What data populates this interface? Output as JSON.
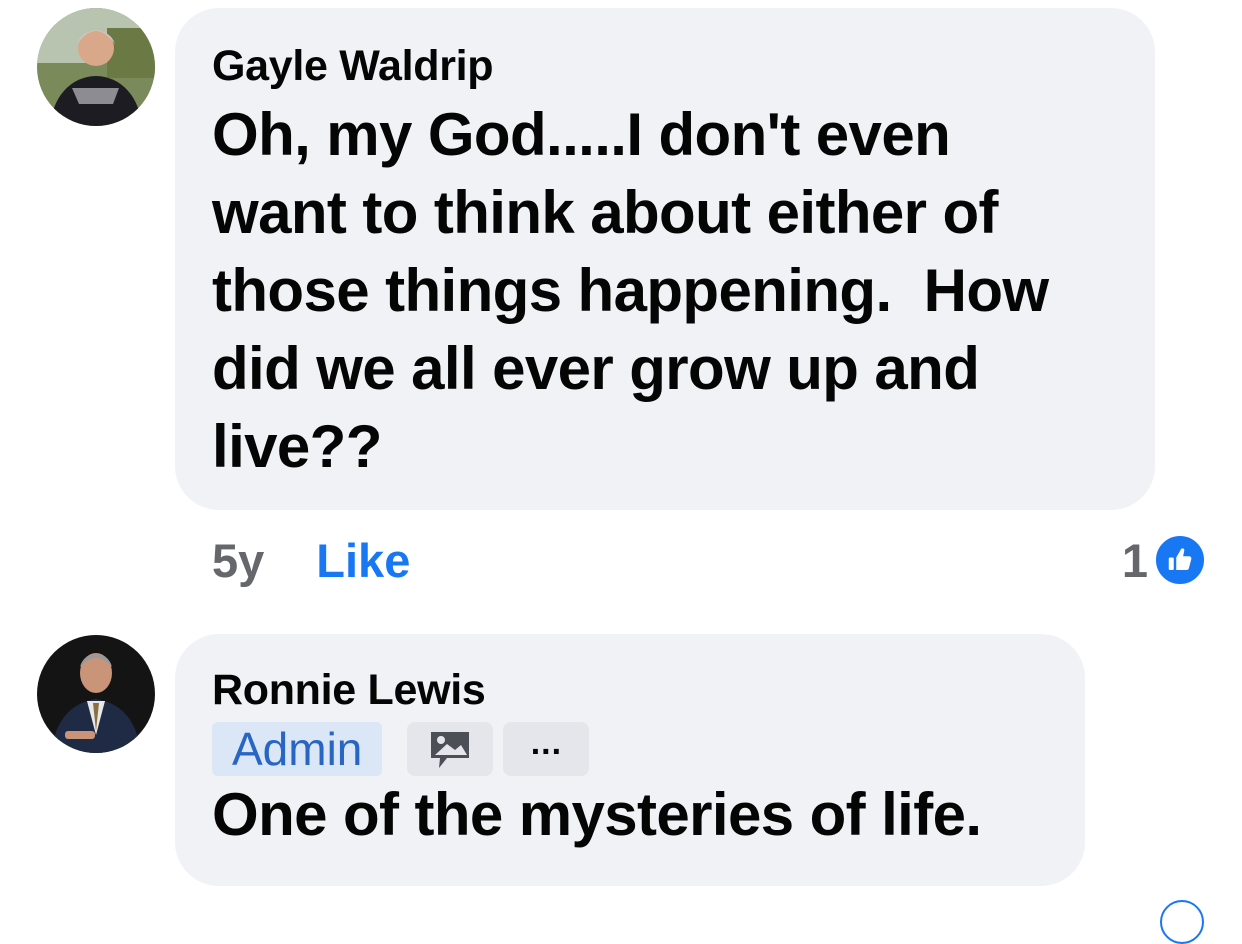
{
  "comments": [
    {
      "author": "Gayle Waldrip",
      "text": "Oh, my God.....I don't even\nwant to think about either of\nthose things happening.  How\ndid we all ever grow up and\nlive??",
      "age": "5y",
      "like_label": "Like",
      "reaction_count": "1",
      "avatar_icon": "profile-photo-woman",
      "reaction_icon": "thumbs-up-icon"
    },
    {
      "author": "Ronnie Lewis",
      "badge": "Admin",
      "photo_icon": "photo-comment-icon",
      "more_label": "...",
      "text": "One of the mysteries of life.",
      "avatar_icon": "profile-photo-man"
    }
  ],
  "colors": {
    "bubble_bg": "#f0f2f5",
    "link_blue": "#1877f2",
    "meta_gray": "#65676b",
    "admin_badge_bg": "#dbe7f7",
    "admin_badge_text": "#2866c4"
  }
}
